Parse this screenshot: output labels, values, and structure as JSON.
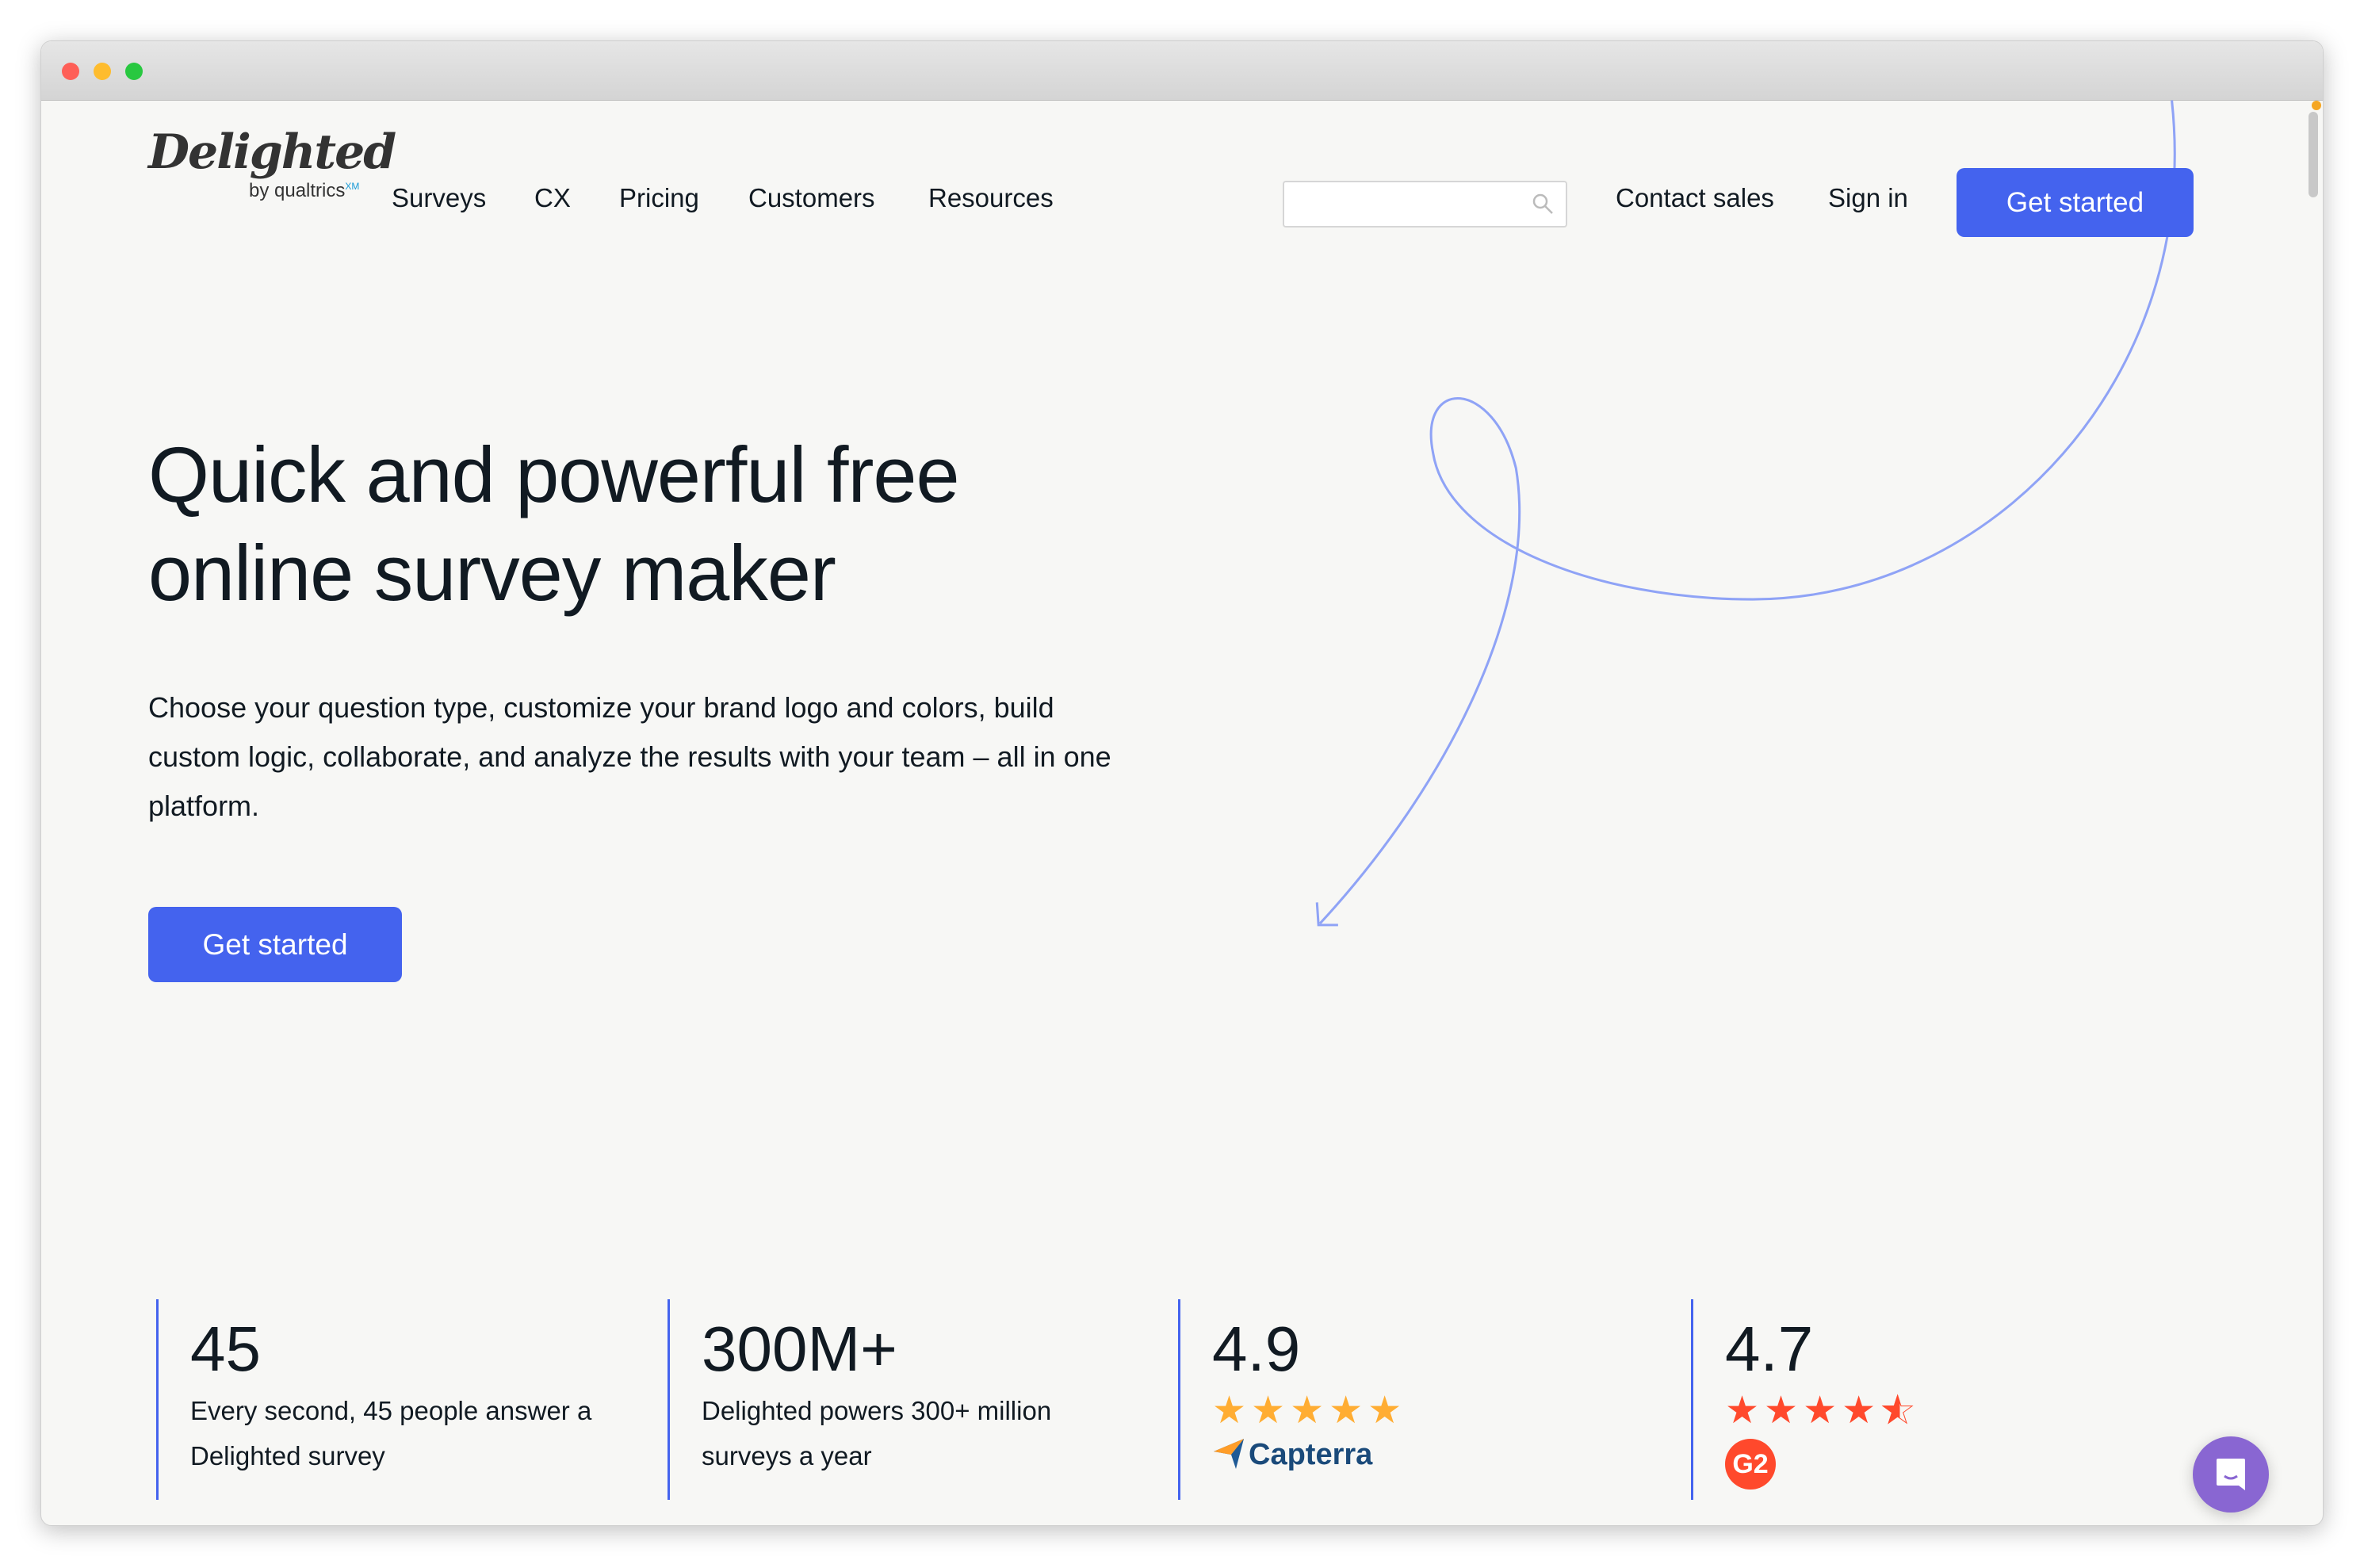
{
  "brand": {
    "logo": "Delighted",
    "sub": "by qualtrics",
    "xm": "XM"
  },
  "nav": {
    "items": [
      "Surveys",
      "CX",
      "Pricing",
      "Customers",
      "Resources"
    ],
    "search_placeholder": "",
    "contact": "Contact sales",
    "signin": "Sign in",
    "cta": "Get started"
  },
  "hero": {
    "title_line1": "Quick and powerful free",
    "title_line2": "online survey maker",
    "paragraph": "Choose your question type, customize your brand logo and colors, build custom logic, collaborate, and analyze the results with your team – all in one platform.",
    "cta": "Get started"
  },
  "stats": [
    {
      "value": "45",
      "text": "Every second, 45 people answer a Delighted survey"
    },
    {
      "value": "300M+",
      "text": "Delighted powers 300+ million surveys a year"
    },
    {
      "value": "4.9",
      "rating": 5,
      "source": "Capterra",
      "star_color": "#ffad33"
    },
    {
      "value": "4.7",
      "rating": 4.5,
      "source": "G2",
      "star_color": "#ff492c"
    }
  ],
  "colors": {
    "accent": "#4463ee",
    "chat": "#8966d2",
    "curve": "#8fa3f6"
  }
}
